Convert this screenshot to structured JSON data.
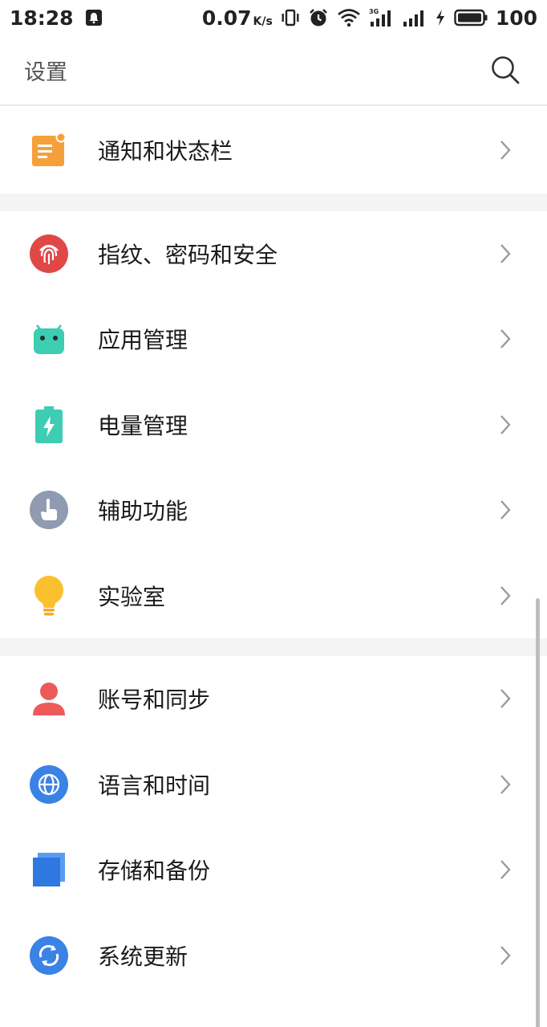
{
  "status_bar": {
    "time": "18:28",
    "net_speed": "0.07",
    "net_unit": "K/s",
    "signal_label": "3G",
    "battery": "100",
    "icons": [
      "notification-icon",
      "vibrate-icon",
      "alarm-icon",
      "wifi-icon",
      "signal-3g-icon",
      "signal-icon",
      "charging-icon",
      "battery-icon"
    ]
  },
  "header": {
    "title": "设置"
  },
  "groups": [
    {
      "items": [
        {
          "label": "通知和状态栏",
          "icon": "notification-bar-icon",
          "color": "#F6A03C"
        }
      ]
    },
    {
      "items": [
        {
          "label": "指纹、密码和安全",
          "icon": "fingerprint-icon",
          "color": "#E04848"
        },
        {
          "label": "应用管理",
          "icon": "android-icon",
          "color": "#3CCDB3"
        },
        {
          "label": "电量管理",
          "icon": "battery-charging-icon",
          "color": "#3CCDB3"
        },
        {
          "label": "辅助功能",
          "icon": "hand-icon",
          "color": "#8E9BB0"
        },
        {
          "label": "实验室",
          "icon": "lightbulb-icon",
          "color": "#FBC02D"
        }
      ]
    },
    {
      "items": [
        {
          "label": "账号和同步",
          "icon": "account-icon",
          "color": "#EC5A5A"
        },
        {
          "label": "语言和时间",
          "icon": "globe-icon",
          "color": "#3B82E6"
        },
        {
          "label": "存储和备份",
          "icon": "storage-icon",
          "color": "#3B82E6"
        },
        {
          "label": "系统更新",
          "icon": "update-icon",
          "color": "#3B82E6"
        }
      ]
    }
  ]
}
